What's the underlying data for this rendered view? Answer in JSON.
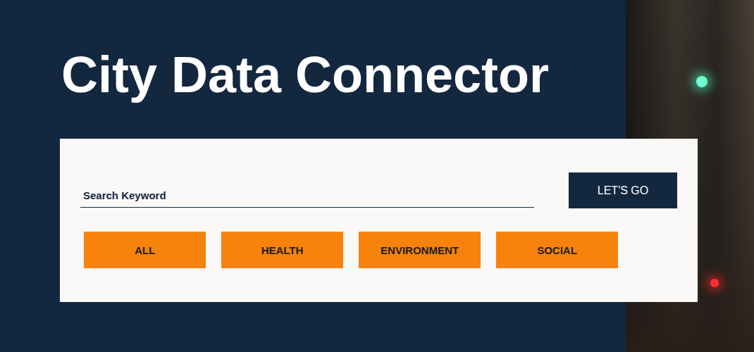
{
  "page": {
    "title": "City Data Connector"
  },
  "search": {
    "placeholder": "Search Keyword",
    "value": ""
  },
  "submit": {
    "label": "LET'S GO"
  },
  "filters": [
    {
      "label": "ALL",
      "selected": false
    },
    {
      "label": "HEALTH",
      "selected": false
    },
    {
      "label": "ENVIRONMENT",
      "selected": false
    },
    {
      "label": "SOCIAL",
      "selected": false
    }
  ]
}
